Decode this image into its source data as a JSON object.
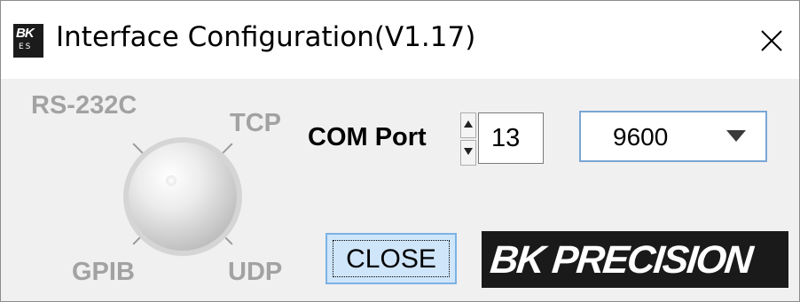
{
  "window": {
    "title": "Interface Configuration(V1.17)",
    "app_icon": {
      "line1": "BK",
      "line2": "ES"
    }
  },
  "selector": {
    "options": [
      "RS-232C",
      "TCP",
      "GPIB",
      "UDP"
    ]
  },
  "com_port": {
    "label": "COM Port",
    "value": "13"
  },
  "baud_rate": {
    "value": "9600"
  },
  "buttons": {
    "close_label": "CLOSE"
  },
  "logo": {
    "text": "BK PRECISION"
  },
  "colors": {
    "accent_border": "#7aa6d6",
    "button_fill": "#cfe5fa",
    "logo_bg": "#1a1a1a",
    "disabled_text": "#a2a2a2"
  },
  "icons": [
    "app-icon",
    "close-icon",
    "spinner-up-icon",
    "spinner-down-icon",
    "dropdown-arrow-icon"
  ]
}
